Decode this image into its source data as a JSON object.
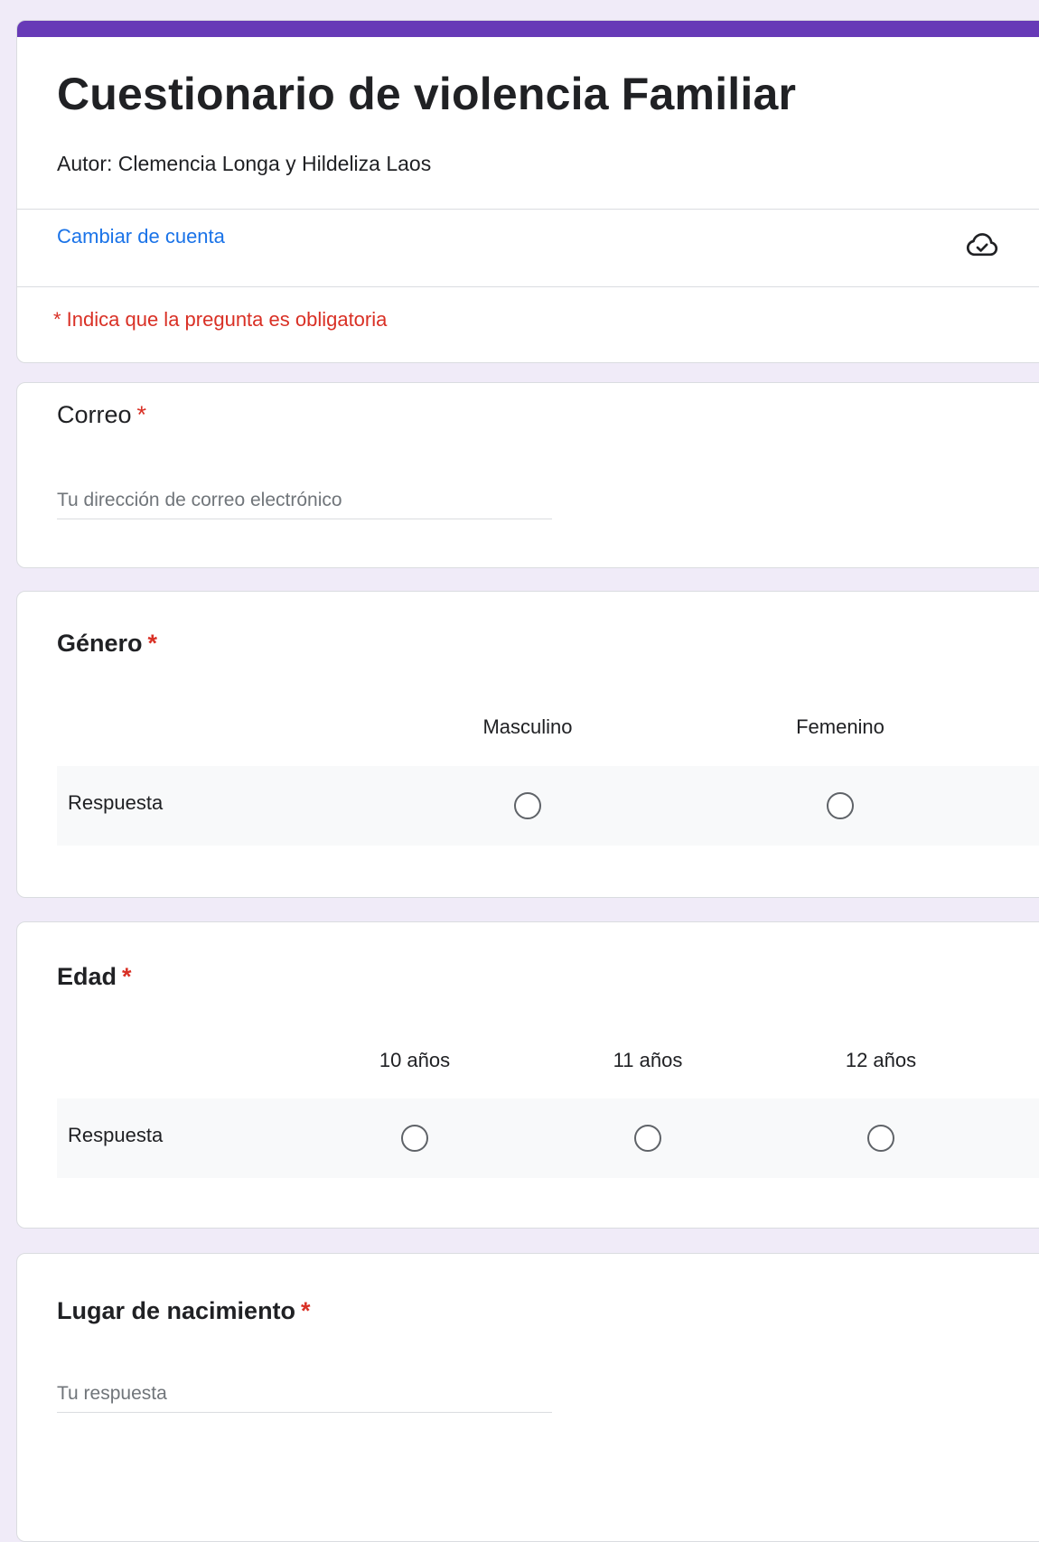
{
  "header": {
    "title": "Cuestionario de violencia Familiar",
    "description": "Autor: Clemencia Longa y Hildeliza Laos",
    "switch_account": "Cambiar de cuenta",
    "required_note": "* Indica que la pregunta es obligatoria",
    "cloud_icon": "cloud-check-icon"
  },
  "colors": {
    "accent": "#673ab7",
    "background": "#f0ebf8",
    "required": "#d93025",
    "link": "#1a73e8"
  },
  "questions": {
    "correo": {
      "title": "Correo",
      "required_mark": "*",
      "placeholder": "Tu dirección de correo electrónico"
    },
    "genero": {
      "title": "Género",
      "required_mark": "*",
      "columns": [
        "Masculino",
        "Femenino"
      ],
      "row_label": "Respuesta"
    },
    "edad": {
      "title": "Edad",
      "required_mark": "*",
      "columns": [
        "10 años",
        "11 años",
        "12 años"
      ],
      "row_label": "Respuesta"
    },
    "lugar": {
      "title": "Lugar de nacimiento",
      "required_mark": "*",
      "placeholder": "Tu respuesta"
    }
  }
}
